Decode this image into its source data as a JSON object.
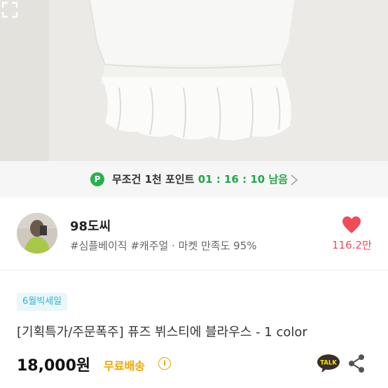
{
  "point_banner": {
    "badge": "P",
    "text": "무조건 1천 포인트",
    "timer": "01 : 16 : 10",
    "suffix": "남음"
  },
  "shop": {
    "name": "98도씨",
    "tags": "#심플베이직 #캐주얼",
    "satisfaction": "· 마켓 만족도 95%",
    "likes": "116.2만"
  },
  "product": {
    "event_tag": "6월빅세일",
    "title": "[기획특가/주문폭주] 퓨즈 뷔스티에 블라우스 - 1 color",
    "price": "18,000원",
    "shipping": "무료배송",
    "info_glyph": "i"
  },
  "colors": {
    "accent_green": "#23a64a",
    "like_red": "#ee4c5a",
    "shipping_orange": "#f0a500",
    "tag_blue": "#3aaed3"
  },
  "icons": [
    "expand-icon",
    "chevron-right-icon",
    "heart-icon",
    "info-icon",
    "kakaotalk-icon",
    "share-icon"
  ]
}
